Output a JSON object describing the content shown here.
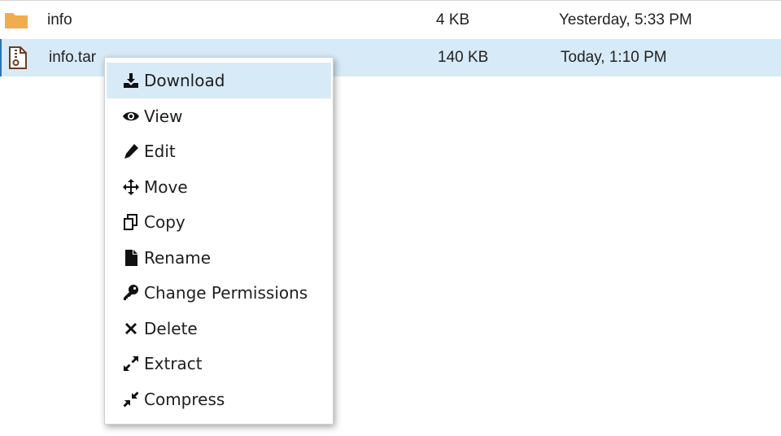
{
  "files": [
    {
      "name": "info",
      "size": "4 KB",
      "modified": "Yesterday, 5:33 PM",
      "icon": "folder-icon",
      "selected": false
    },
    {
      "name": "info.tar",
      "size": "140 KB",
      "modified": "Today, 1:10 PM",
      "icon": "archive-file-icon",
      "selected": true
    }
  ],
  "context_menu": {
    "items": [
      {
        "label": "Download",
        "icon": "download-icon"
      },
      {
        "label": "View",
        "icon": "eye-icon"
      },
      {
        "label": "Edit",
        "icon": "pencil-icon"
      },
      {
        "label": "Move",
        "icon": "move-arrows-icon"
      },
      {
        "label": "Copy",
        "icon": "copy-icon"
      },
      {
        "label": "Rename",
        "icon": "file-icon"
      },
      {
        "label": "Change Permissions",
        "icon": "key-icon"
      },
      {
        "label": "Delete",
        "icon": "x-icon"
      },
      {
        "label": "Extract",
        "icon": "expand-icon"
      },
      {
        "label": "Compress",
        "icon": "compress-icon"
      }
    ]
  },
  "colors": {
    "selected_row": "#d7eaf7",
    "folder": "#f0ad4e",
    "archive_icon": "#6b3e26"
  }
}
